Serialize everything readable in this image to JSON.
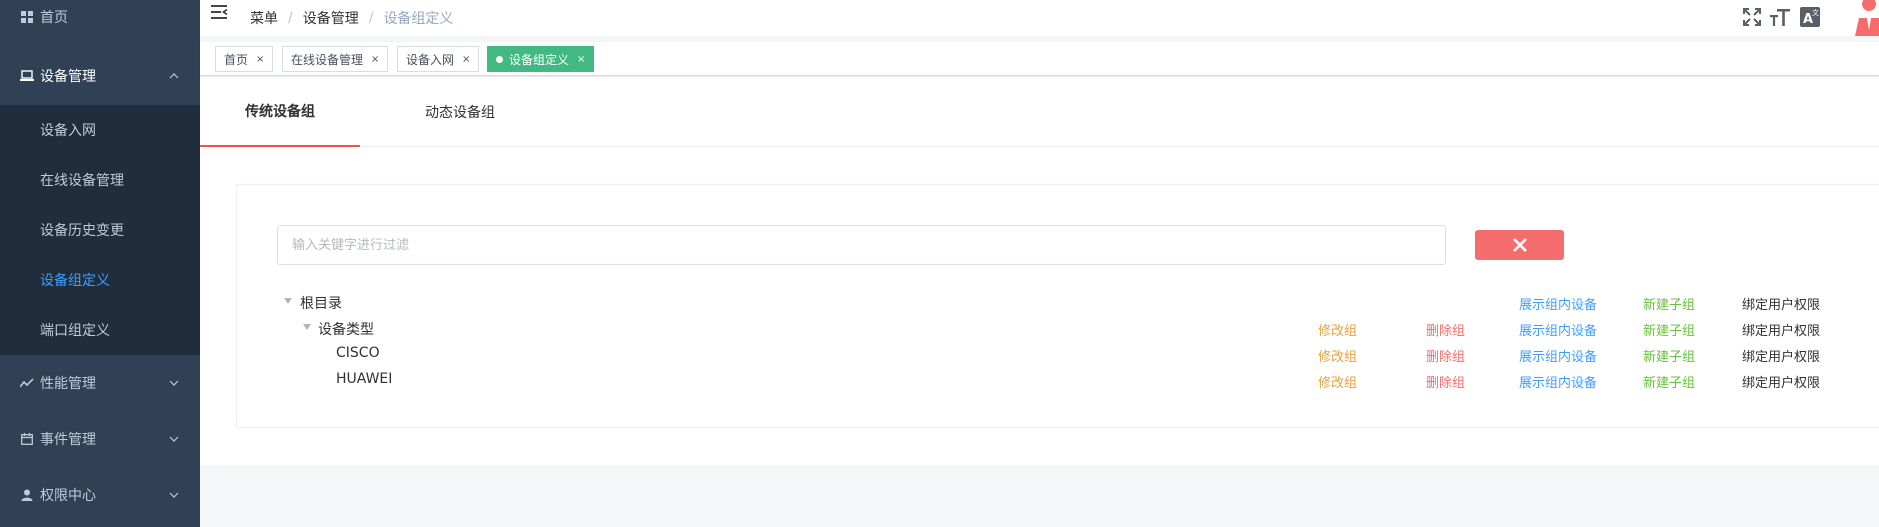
{
  "sidebar": {
    "home": "首页",
    "device_mgmt": "设备管理",
    "device_sub": [
      "设备入网",
      "在线设备管理",
      "设备历史变更",
      "设备组定义",
      "端口组定义"
    ],
    "perf": "性能管理",
    "event": "事件管理",
    "perm": "权限中心"
  },
  "header": {
    "breadcrumb": [
      "菜单",
      "设备管理",
      "设备组定义"
    ],
    "separator": "/"
  },
  "tags": [
    {
      "label": "首页",
      "close": "×"
    },
    {
      "label": "在线设备管理",
      "close": "×"
    },
    {
      "label": "设备入网",
      "close": "×"
    },
    {
      "label": "设备组定义",
      "close": "×"
    }
  ],
  "tabs": [
    "传统设备组",
    "动态设备组"
  ],
  "search": {
    "placeholder": "输入关键字进行过滤"
  },
  "tree": {
    "nodes": [
      {
        "label": "根目录"
      },
      {
        "label": "设备类型"
      },
      {
        "label": "CISCO"
      },
      {
        "label": "HUAWEI"
      }
    ],
    "actions": {
      "edit": "修改组",
      "delete": "删除组",
      "show": "展示组内设备",
      "add": "新建子组",
      "bind": "绑定用户权限"
    }
  },
  "colors": {
    "sidebar_bg": "#304156",
    "sidebar_active": "#409eff",
    "tag_active": "#42b983",
    "tab_underline": "#f5533d",
    "clear_button": "#f56c6c"
  }
}
